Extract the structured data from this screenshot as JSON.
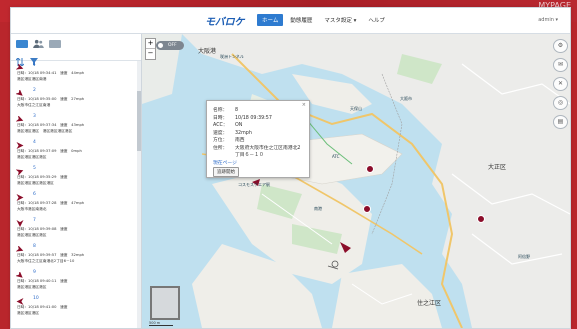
{
  "window": {
    "background_right_text": "MYPAGE",
    "accent": "#2e7bd0",
    "brand_red": "#b9262c"
  },
  "header": {
    "logo": "モバロケ",
    "nav": [
      {
        "label": "ホーム",
        "active": true
      },
      {
        "label": "動態履歴",
        "active": false
      },
      {
        "label": "マスタ設定 ▾",
        "active": false
      },
      {
        "label": "ヘルプ",
        "active": false
      }
    ],
    "user": "admin ▾"
  },
  "sidebar": {
    "tools": [
      "list-view-icon",
      "people-icon",
      "card-view-icon"
    ],
    "filters": [
      "sort-icon",
      "filter-icon"
    ],
    "vehicles": [
      {
        "num": "1",
        "line1": "日時：10/18 09:34:41　速度　44mph",
        "line2": "港区港区港区南港",
        "color": "#8b0d2a",
        "dir": 200
      },
      {
        "num": "2",
        "line1": "日時：10/18 09:35:00　速度　27mph",
        "line2": "大阪市住之江区南港",
        "color": "#8b0d2a",
        "dir": 220
      },
      {
        "num": "3",
        "line1": "日時：10/18 09:37:34　速度　43mph",
        "line2": "港区港区港区　港区港区港区港区",
        "color": "#8b0d2a",
        "dir": 200
      },
      {
        "num": "4",
        "line1": "日時：10/18 09:37:09　速度　0mph",
        "line2": "港区港区港区港区",
        "color": "#8b0d2a",
        "dir": 180
      },
      {
        "num": "5",
        "line1": "日時：10/18 09:35:29　速度",
        "line2": "港区港区港区港区港区",
        "color": "#8b0d2a",
        "dir": 160
      },
      {
        "num": "6",
        "line1": "日時：10/18 09:37:28　速度　47mph",
        "line2": "大阪市港区南港北",
        "color": "#8b0d2a",
        "dir": 180
      },
      {
        "num": "7",
        "line1": "日時：10/18 09:39:08　速度",
        "line2": "港区港区港区港区",
        "color": "#8b0d2a",
        "dir": 270
      },
      {
        "num": "8",
        "line1": "日時：10/18 09:39:57　速度　32mph",
        "line2": "大阪市住之江区南港北2丁目6－10",
        "color": "#8b0d2a",
        "dir": 200
      },
      {
        "num": "9",
        "line1": "日時：10/18 09:40:11　速度",
        "line2": "港区港区港区港区",
        "color": "#8b0d2a",
        "dir": 220
      },
      {
        "num": "10",
        "line1": "日時：10/18 09:41:00　速度",
        "line2": "港区港区港区",
        "color": "#8b0d2a",
        "dir": 0
      }
    ]
  },
  "map": {
    "zoom_in": "+",
    "zoom_out": "−",
    "toggle_label": "OFF",
    "scale_label": "500 m",
    "right_tools": [
      "⚙",
      "✉",
      "✕",
      "◎",
      "▤"
    ],
    "labels": [
      {
        "text": "大阪港",
        "cls": "big"
      },
      {
        "text": "大正区",
        "cls": "big"
      },
      {
        "text": "住之江区",
        "cls": "big"
      },
      {
        "text": "咲洲トンネル",
        "cls": ""
      },
      {
        "text": "大阪市",
        "cls": ""
      },
      {
        "text": "南港",
        "cls": ""
      },
      {
        "text": "コスモスクエア駅",
        "cls": ""
      },
      {
        "text": "ATC",
        "cls": ""
      },
      {
        "text": "天保山",
        "cls": ""
      },
      {
        "text": "阿倍野",
        "cls": ""
      }
    ]
  },
  "popup": {
    "rows": [
      {
        "k": "名称：",
        "v": "8"
      },
      {
        "k": "日時：",
        "v": "10/18 09:39:57"
      },
      {
        "k": "ACC：",
        "v": "ON"
      },
      {
        "k": "速度：",
        "v": "32mph"
      },
      {
        "k": "方位：",
        "v": "南西"
      },
      {
        "k": "住所：",
        "v": "大阪府大阪市住之江区南港北2"
      },
      {
        "k": "",
        "v": "丁目６－１０"
      }
    ],
    "link": "現在ページ",
    "button": "追跡開始",
    "close": "×"
  }
}
